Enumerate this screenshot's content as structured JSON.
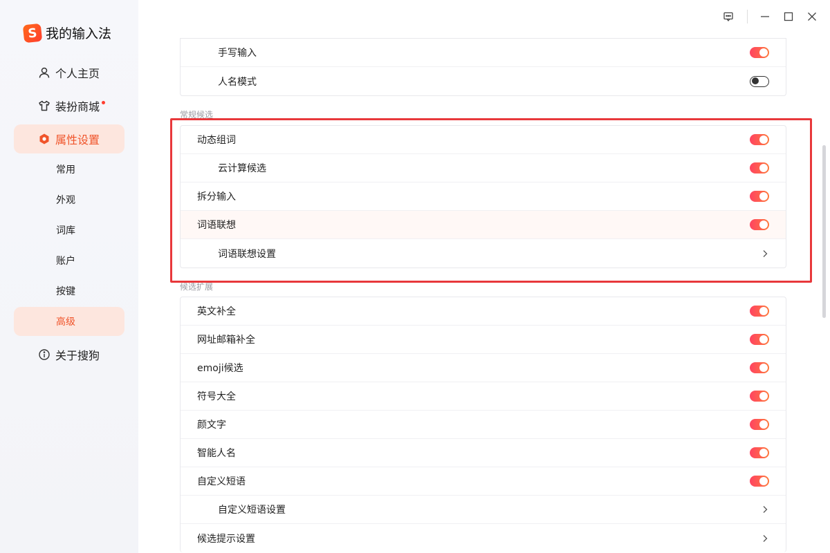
{
  "app": {
    "title": "我的输入法",
    "logo_glyph": "S",
    "accent": "#f0542a"
  },
  "sidebar": {
    "items": [
      {
        "label": "个人主页",
        "icon": "user-icon"
      },
      {
        "label": "装扮商城",
        "icon": "shirt-icon",
        "badge": true
      },
      {
        "label": "属性设置",
        "icon": "hexagon-settings-icon",
        "active": true
      },
      {
        "label": "关于搜狗",
        "icon": "info-icon"
      }
    ],
    "subitems": [
      {
        "label": "常用"
      },
      {
        "label": "外观"
      },
      {
        "label": "词库"
      },
      {
        "label": "账户"
      },
      {
        "label": "按键"
      },
      {
        "label": "高级",
        "active": true
      }
    ]
  },
  "sections": {
    "top_group": [
      {
        "label": "手写输入",
        "toggle": true
      },
      {
        "label": "人名模式",
        "toggle": false
      }
    ],
    "candidate": {
      "title": "常规候选",
      "rows": [
        {
          "label": "动态组词",
          "toggle": true
        },
        {
          "label": "云计算候选",
          "toggle": true
        },
        {
          "label": "拆分输入",
          "toggle": true
        },
        {
          "label": "词语联想",
          "toggle": true
        },
        {
          "label": "词语联想设置"
        }
      ]
    },
    "extension": {
      "title": "候选扩展",
      "rows": [
        {
          "label": "英文补全",
          "toggle": true
        },
        {
          "label": "网址邮箱补全",
          "toggle": true
        },
        {
          "label": "emoji候选",
          "toggle": true
        },
        {
          "label": "符号大全",
          "toggle": true
        },
        {
          "label": "颜文字",
          "toggle": true
        },
        {
          "label": "智能人名",
          "toggle": true
        },
        {
          "label": "自定义短语",
          "toggle": true
        },
        {
          "label": "自定义短语设置"
        },
        {
          "label": "候选提示设置"
        }
      ]
    }
  }
}
